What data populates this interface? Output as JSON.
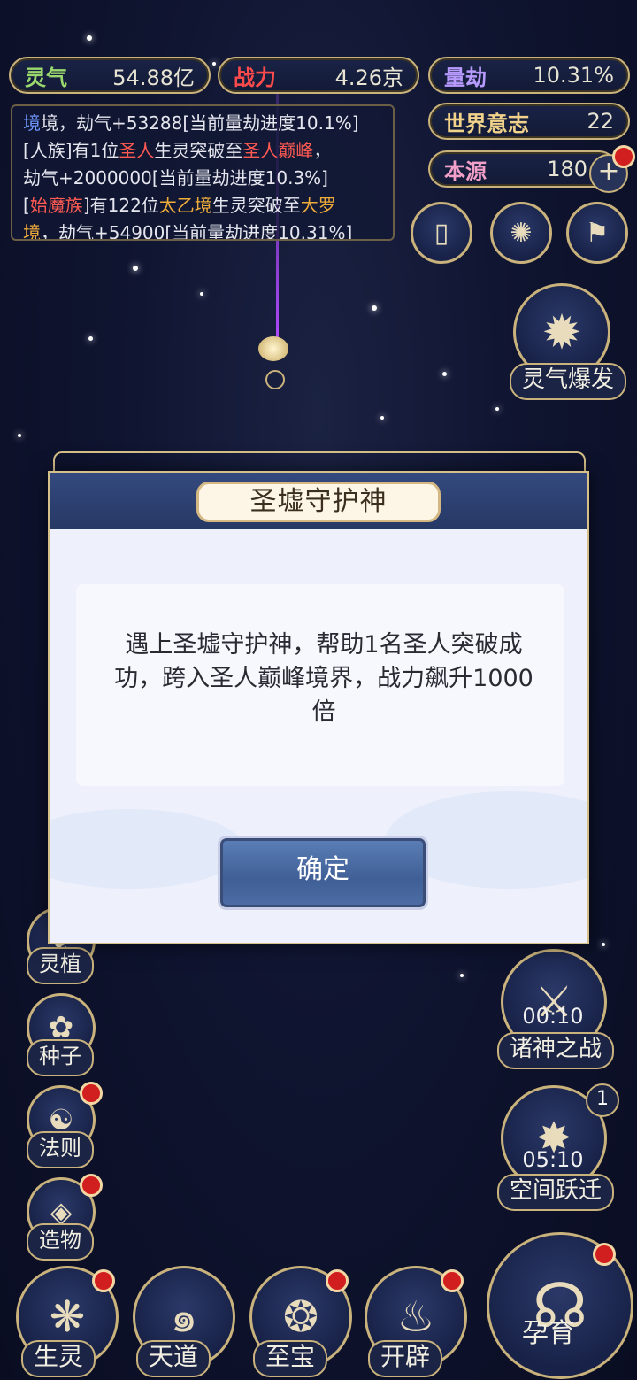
{
  "stats": {
    "lingqi": {
      "label": "灵气",
      "value": "54.88亿"
    },
    "zhanli": {
      "label": "战力",
      "value": "4.26京"
    },
    "liangjie": {
      "label": "量劫",
      "value": "10.31%"
    },
    "shijie": {
      "label": "世界意志",
      "value": "22"
    },
    "benyuan": {
      "label": "本源",
      "value": "180"
    }
  },
  "log": {
    "l1a": "境，劫气+53288[当前量劫进度10.1%]",
    "l2a": "[人族]有1位",
    "l2b": "圣人",
    "l2c": "生灵突破至",
    "l2d": "圣人巅峰",
    "l2e": "，",
    "l3a": "劫气+2000000[当前量劫进度10.3%]",
    "l4a": "[",
    "l4b": "始魔族",
    "l4c": "]有122位",
    "l4d": "太乙境",
    "l4e": "生灵突破至",
    "l4f": "大罗",
    "l5a": "境",
    "l5b": "，劫气+54900[当前量劫进度10.31%]"
  },
  "right_buttons": {
    "burst": "灵气爆发",
    "gods_war": "诸神之战",
    "gods_war_timer": "00:10",
    "space_jump": "空间跃迁",
    "space_jump_timer": "05:10",
    "space_jump_badge": "1",
    "yun_yu": "孕育"
  },
  "left_buttons": {
    "ling_zhi": "灵植",
    "zhong_zi": "种子",
    "fa_ze": "法则",
    "zao_wu": "造物"
  },
  "bottom_nav": {
    "sheng_ling": "生灵",
    "tian_dao": "天道",
    "zhi_bao": "至宝",
    "kai_pi": "开辟"
  },
  "modal": {
    "title": "圣墟守护神",
    "message": "遇上圣墟守护神，帮助1名圣人突破成功，跨入圣人巅峰境界，战力飙升1000倍",
    "confirm": "确定"
  }
}
